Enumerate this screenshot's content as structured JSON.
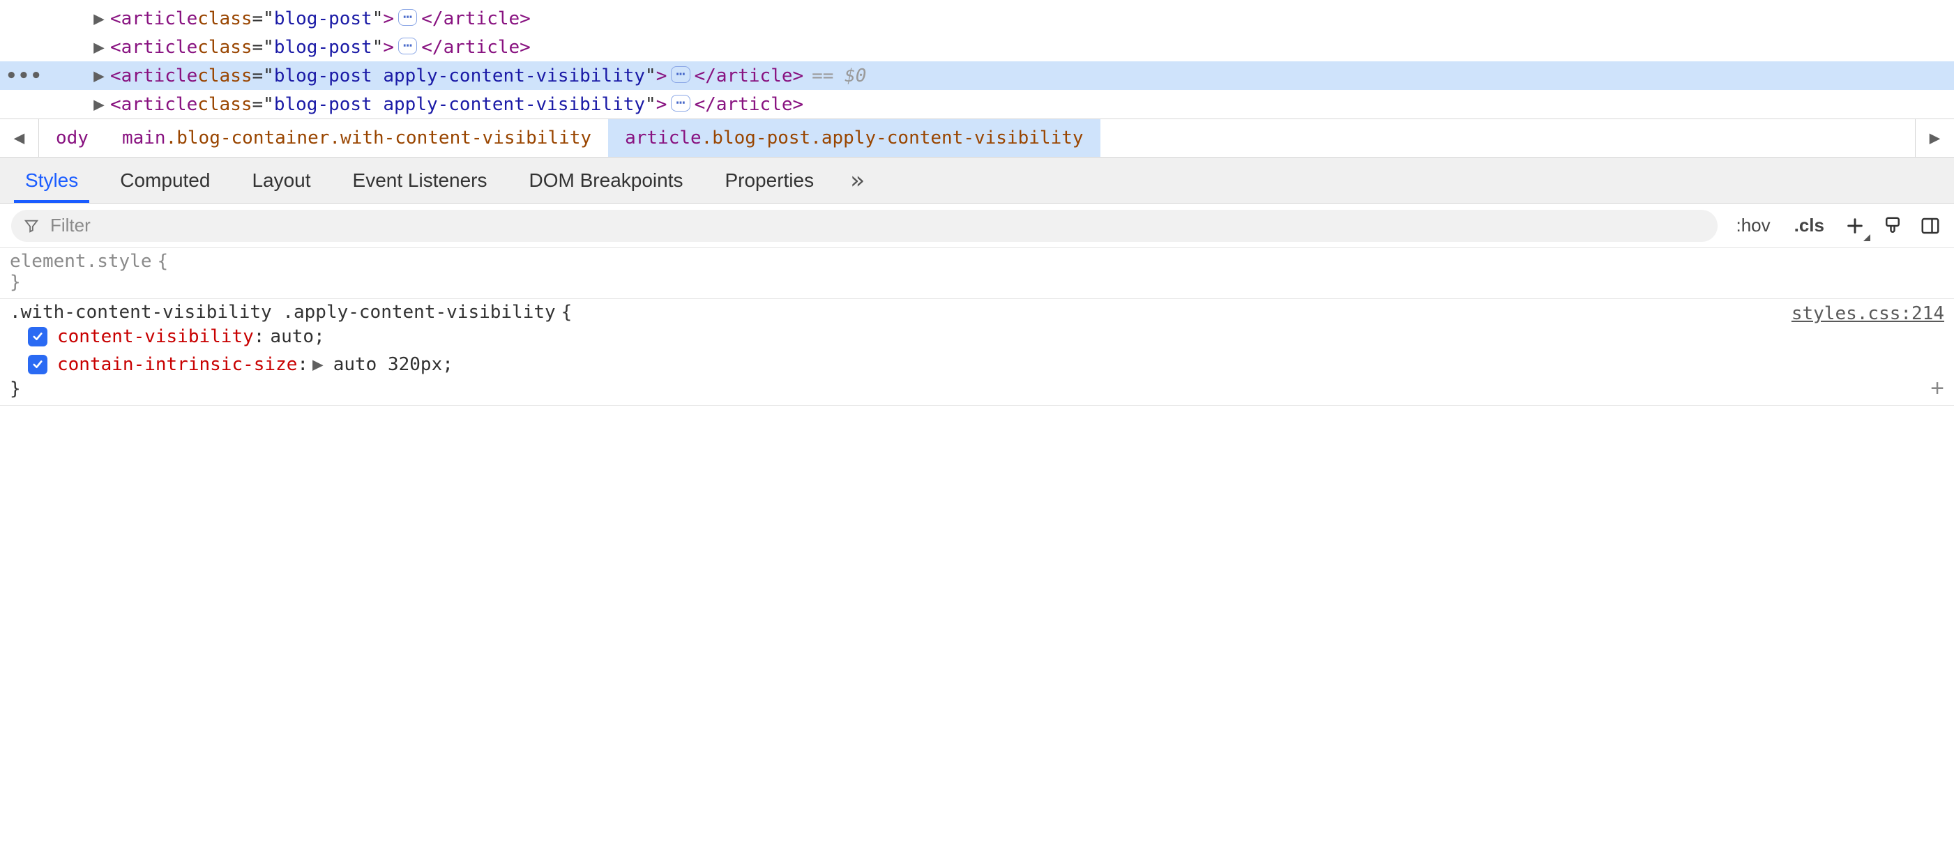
{
  "dom_rows": [
    {
      "indent": 130,
      "selected": false,
      "gutter": "",
      "tag": "article",
      "attr_name": "class",
      "attr_val": "blog-post ",
      "suffix": ""
    },
    {
      "indent": 130,
      "selected": false,
      "gutter": "",
      "tag": "article",
      "attr_name": "class",
      "attr_val": "blog-post ",
      "suffix": ""
    },
    {
      "indent": 130,
      "selected": true,
      "gutter": "•••",
      "tag": "article",
      "attr_name": "class",
      "attr_val": "blog-post apply-content-visibility",
      "suffix": "== $0"
    },
    {
      "indent": 130,
      "selected": false,
      "gutter": "",
      "tag": "article",
      "attr_name": "class",
      "attr_val": "blog-post apply-content-visibility",
      "suffix": ""
    }
  ],
  "breadcrumb": {
    "items": [
      {
        "tag": "ody",
        "cls": "",
        "selected": false
      },
      {
        "tag": "main",
        "cls": ".blog-container.with-content-visibility",
        "selected": false
      },
      {
        "tag": "article",
        "cls": ".blog-post.apply-content-visibility",
        "selected": true
      }
    ]
  },
  "tabs": [
    "Styles",
    "Computed",
    "Layout",
    "Event Listeners",
    "DOM Breakpoints",
    "Properties"
  ],
  "active_tab": 0,
  "filter": {
    "placeholder": "Filter"
  },
  "toolbar": {
    "hov": ":hov",
    "cls": ".cls"
  },
  "rules": [
    {
      "selector": "element.style",
      "faded": true,
      "source": "",
      "declarations": []
    },
    {
      "selector": ".with-content-visibility .apply-content-visibility",
      "faded": false,
      "source": "styles.css:214",
      "declarations": [
        {
          "name": "content-visibility",
          "value": "auto",
          "expandable": false,
          "checked": true
        },
        {
          "name": "contain-intrinsic-size",
          "value": "auto 320px",
          "expandable": true,
          "checked": true
        }
      ]
    }
  ],
  "glyph": {
    "disclosure_right": "▶",
    "ellipsis": "⋯",
    "overflow": "≫",
    "chevron_left": "◀",
    "chevron_right": "▶"
  }
}
